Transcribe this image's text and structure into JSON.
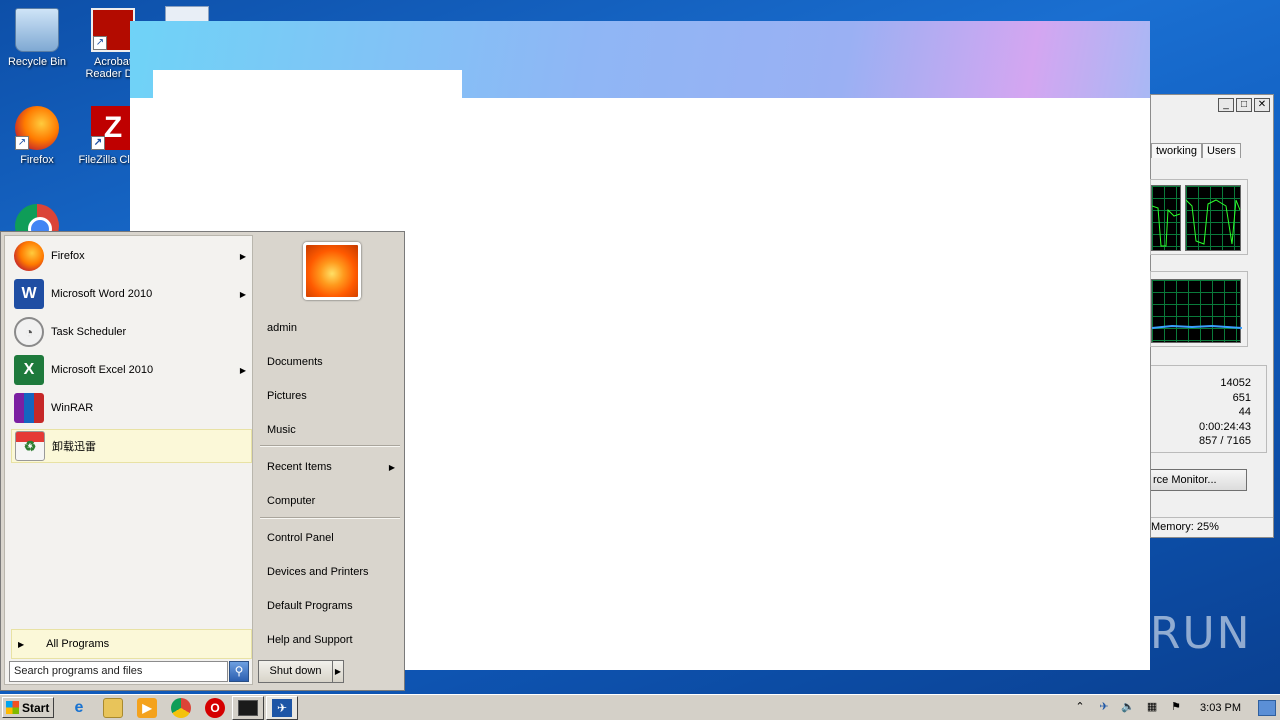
{
  "desktop": {
    "icons": [
      {
        "label": "Recycle Bin"
      },
      {
        "label": "Acrobat Reader DC"
      },
      {
        "label": "Firefox"
      },
      {
        "label": "FileZilla Client"
      }
    ]
  },
  "task_manager": {
    "tabs": [
      "tworking",
      "Users"
    ],
    "stats": [
      "14052",
      "651",
      "44",
      "0:00:24:43",
      "857 / 7165"
    ],
    "resource_monitor_button": "rce Monitor...",
    "status": "Memory: 25%"
  },
  "start_menu": {
    "programs": [
      {
        "label": "Firefox",
        "has_submenu": true
      },
      {
        "label": "Microsoft Word 2010",
        "has_submenu": true
      },
      {
        "label": "Task Scheduler",
        "has_submenu": false
      },
      {
        "label": "Microsoft Excel 2010",
        "has_submenu": true
      },
      {
        "label": "WinRAR",
        "has_submenu": false
      },
      {
        "label": "卸载迅雷",
        "has_submenu": false
      }
    ],
    "all_programs": "All Programs",
    "search_placeholder": "Search programs and files",
    "right_links": {
      "user": "admin",
      "documents": "Documents",
      "pictures": "Pictures",
      "music": "Music",
      "recent_items": "Recent Items",
      "computer": "Computer",
      "control_panel": "Control Panel",
      "devices_printers": "Devices and Printers",
      "default_programs": "Default Programs",
      "help_support": "Help and Support"
    },
    "shutdown_label": "Shut down"
  },
  "taskbar": {
    "start_label": "Start",
    "clock": "3:03 PM"
  },
  "watermark": "ANY RUN"
}
